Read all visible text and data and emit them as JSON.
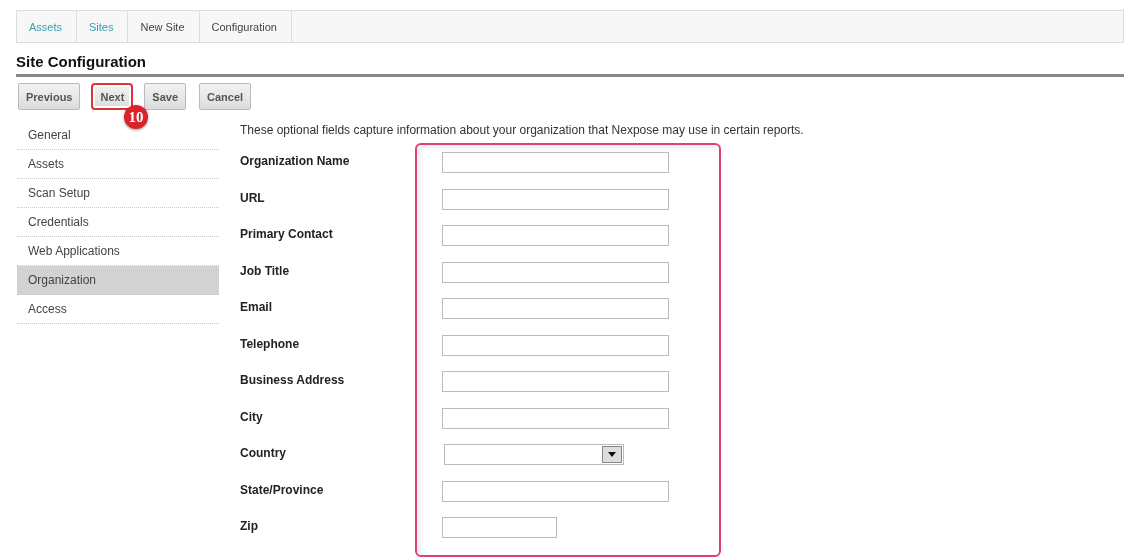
{
  "breadcrumbs": [
    {
      "label": "Assets",
      "link": true
    },
    {
      "label": "Sites",
      "link": true
    },
    {
      "label": "New Site",
      "link": false
    },
    {
      "label": "Configuration",
      "link": false
    }
  ],
  "title": "Site Configuration",
  "buttons": [
    {
      "label": "Previous",
      "highlighted": false
    },
    {
      "label": "Next",
      "highlighted": true
    },
    {
      "label": "Save",
      "highlighted": false
    },
    {
      "label": "Cancel",
      "highlighted": false
    }
  ],
  "step_badge": "10",
  "sidebar": {
    "items": [
      {
        "label": "General",
        "selected": false
      },
      {
        "label": "Assets",
        "selected": false
      },
      {
        "label": "Scan Setup",
        "selected": false
      },
      {
        "label": "Credentials",
        "selected": false
      },
      {
        "label": "Web Applications",
        "selected": false
      },
      {
        "label": "Organization",
        "selected": true
      },
      {
        "label": "Access",
        "selected": false
      }
    ]
  },
  "description": "These optional fields capture information about your organization that Nexpose may use in certain reports.",
  "fields": [
    {
      "label": "Organization Name",
      "kind": "text"
    },
    {
      "label": "URL",
      "kind": "text"
    },
    {
      "label": "Primary Contact",
      "kind": "text"
    },
    {
      "label": "Job Title",
      "kind": "text"
    },
    {
      "label": "Email",
      "kind": "text"
    },
    {
      "label": "Telephone",
      "kind": "text"
    },
    {
      "label": "Business Address",
      "kind": "text"
    },
    {
      "label": "City",
      "kind": "text"
    },
    {
      "label": "Country",
      "kind": "select"
    },
    {
      "label": "State/Province",
      "kind": "text"
    },
    {
      "label": "Zip",
      "kind": "short"
    }
  ]
}
